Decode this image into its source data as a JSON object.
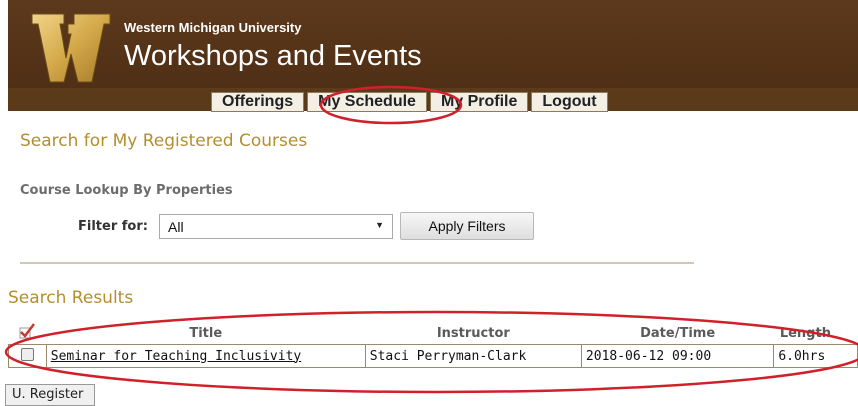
{
  "header": {
    "university": "Western Michigan University",
    "title": "Workshops and Events",
    "logo_letter": "W"
  },
  "nav": {
    "items": [
      {
        "label": "Offerings"
      },
      {
        "label": "My Schedule"
      },
      {
        "label": "My Profile"
      },
      {
        "label": "Logout"
      }
    ]
  },
  "search": {
    "title": "Search for My Registered Courses",
    "lookup_label": "Course Lookup By Properties",
    "filter_label": "Filter for:",
    "filter_value": "All",
    "apply_label": "Apply Filters"
  },
  "results": {
    "title": "Search Results",
    "columns": [
      "Title",
      "Instructor",
      "Date/Time",
      "Length"
    ],
    "rows": [
      {
        "title": "Seminar for Teaching Inclusivity",
        "instructor": "Staci Perryman-Clark",
        "datetime": "2018-06-12 09:00",
        "length": "6.0hrs"
      }
    ]
  },
  "footer": {
    "unregister_label": "U. Register"
  },
  "colors": {
    "brand_brown": "#5e3a1c",
    "accent_gold": "#b38e2f",
    "annotation_red": "#d0202a"
  }
}
